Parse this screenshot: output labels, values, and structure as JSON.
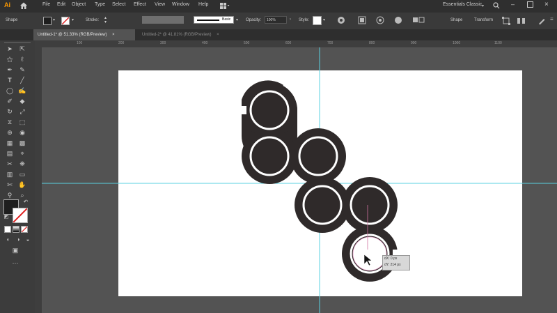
{
  "app": {
    "logo": "Ai",
    "home_icon": "home-icon"
  },
  "menu": [
    "File",
    "Edit",
    "Object",
    "Type",
    "Select",
    "Effect",
    "View",
    "Window",
    "Help"
  ],
  "workspace_name": "Essentials Classic",
  "control_bar": {
    "selection_label": "Shape",
    "stroke_label": "Stroke:",
    "stroke_value": "",
    "brush_label": "Basic",
    "opacity_label": "Opacity:",
    "opacity_value": "100%",
    "style_label": "Style:",
    "shape_button": "Shape",
    "transform_button": "Transform"
  },
  "tabs": [
    {
      "label": "Untitled-1* @ 51.33% (RGB/Preview)",
      "active": true
    },
    {
      "label": "Untitled-2* @ 41.81% (RGB/Preview)",
      "active": false
    }
  ],
  "ruler_numbers": [
    "100",
    "200",
    "300",
    "400",
    "500",
    "600",
    "700",
    "800",
    "900",
    "1000",
    "1100"
  ],
  "measure_tooltip": {
    "dx": "dX: 0 px",
    "dy": "dY: 214 px"
  },
  "colors": {
    "shape": "#2f2a2a",
    "guide": "#5ad0e0",
    "artboard": "#ffffff",
    "fill_swatch": "#1e1e1e"
  }
}
